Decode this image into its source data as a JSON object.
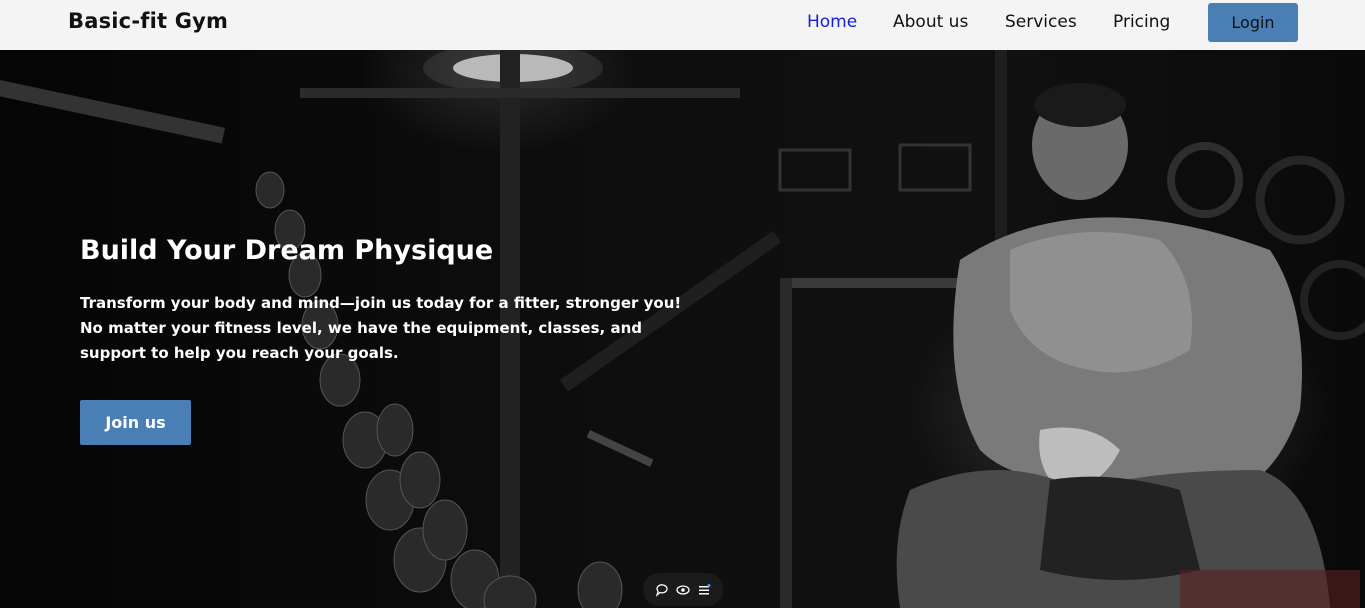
{
  "header": {
    "brand": "Basic-fit Gym",
    "nav": [
      {
        "label": "Home",
        "active": true
      },
      {
        "label": "About us"
      },
      {
        "label": "Services"
      },
      {
        "label": "Pricing"
      }
    ],
    "login_label": "Login"
  },
  "hero": {
    "title": "Build Your Dream Physique",
    "text_lines": [
      "Transform your body and mind—join us today for a fitter, stronger you!",
      "No matter your fitness level, we have the equipment, classes, and",
      "support to help you reach your goals."
    ],
    "cta_label": "Join us"
  },
  "toolbar": {
    "icons": [
      "comment-icon",
      "eye-icon",
      "menu-icon"
    ]
  },
  "colors": {
    "accent": "#4a7fb5",
    "active_link": "#1a20d8",
    "header_bg": "#f4f4f4"
  }
}
